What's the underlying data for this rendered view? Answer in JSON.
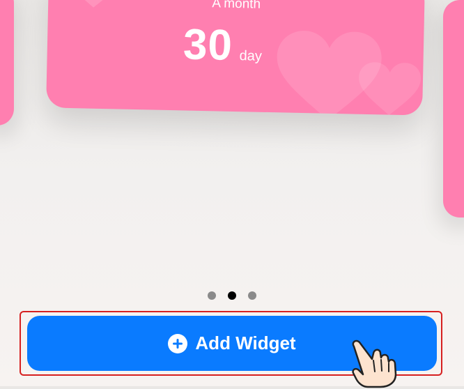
{
  "widget_preview": {
    "caption": "A month",
    "value": "30",
    "unit": "day",
    "card_color": "#ff7fb0"
  },
  "pager": {
    "page_count": 3,
    "active_index": 1
  },
  "add_widget_button": {
    "label": "Add Widget",
    "icon": "plus-circle-icon",
    "color": "#0a7bff"
  },
  "annotations": {
    "highlight_color": "#d62020",
    "pointer_icon": "hand-pointer-icon"
  }
}
